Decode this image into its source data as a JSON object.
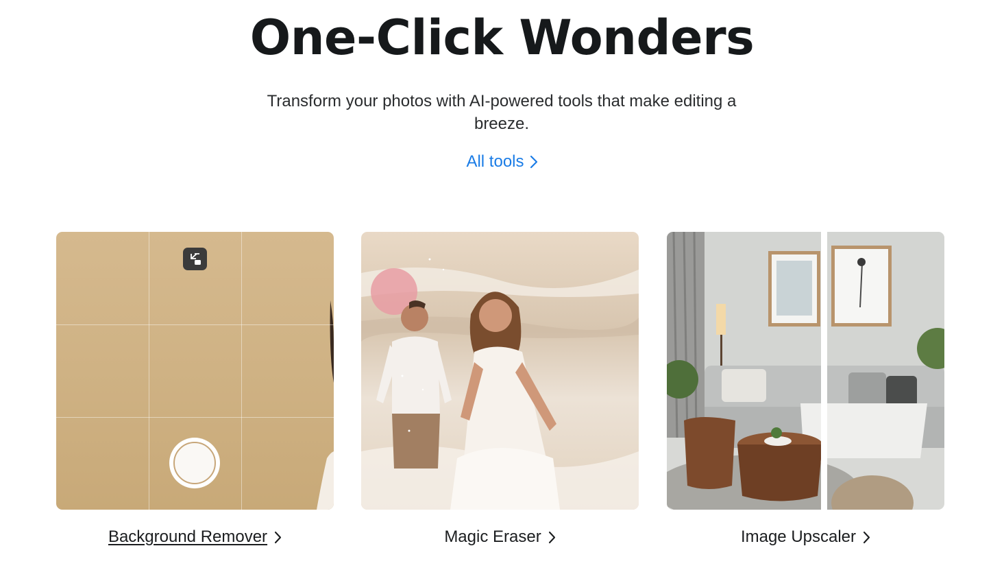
{
  "header": {
    "title": "One-Click Wonders",
    "subtitle": "Transform your photos with AI-powered tools that make editing a breeze.",
    "all_tools_label": "All tools"
  },
  "colors": {
    "link": "#1a7ce6",
    "title": "#16191b",
    "bg_remover_backdrop": "#cfb284"
  },
  "tools": [
    {
      "label": "Background Remover",
      "icon": "chevron-right-icon"
    },
    {
      "label": "Magic Eraser",
      "icon": "chevron-right-icon"
    },
    {
      "label": "Image Upscaler",
      "icon": "chevron-right-icon"
    }
  ]
}
